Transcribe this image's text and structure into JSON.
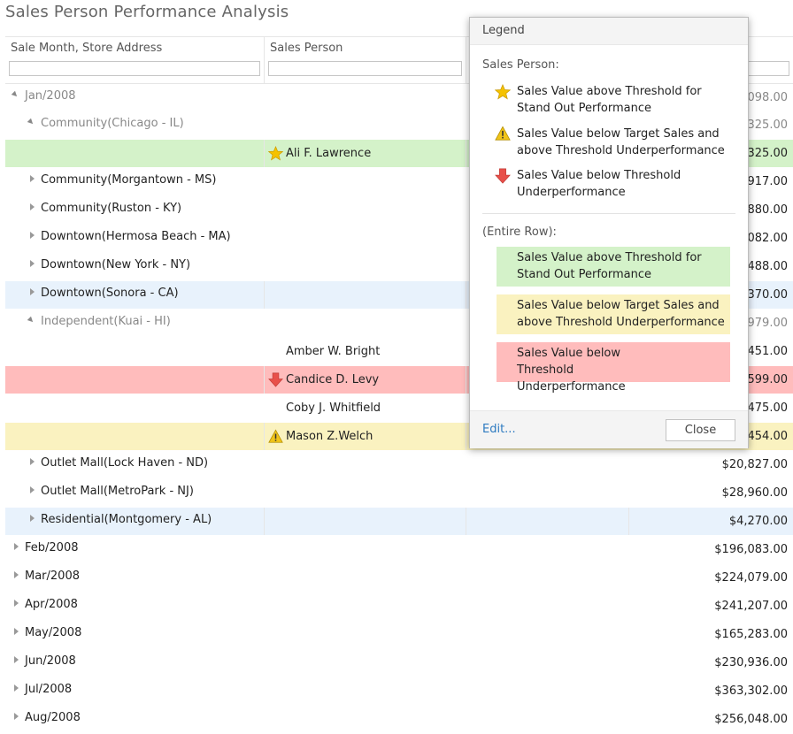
{
  "page": {
    "title": "Sales Person Performance Analysis"
  },
  "columns": {
    "month_store": "Sale Month, Store Address",
    "sales_person": "Sales Person"
  },
  "rows": [
    {
      "label": "Jan/2008",
      "amount": "098.00"
    },
    {
      "label": "Community(Chicago - IL)",
      "amount": "325.00"
    },
    {
      "person": "Ali F. Lawrence",
      "amount": "325.00"
    },
    {
      "label": "Community(Morgantown - MS)",
      "amount": "917.00"
    },
    {
      "label": "Community(Ruston - KY)",
      "amount": "880.00"
    },
    {
      "label": "Downtown(Hermosa Beach - MA)",
      "amount": "082.00"
    },
    {
      "label": "Downtown(New York - NY)",
      "amount": "488.00"
    },
    {
      "label": "Downtown(Sonora - CA)",
      "amount": "370.00"
    },
    {
      "label": "Independent(Kuai - HI)",
      "amount": "979.00"
    },
    {
      "person": "Amber W. Bright",
      "amount": "451.00"
    },
    {
      "person": "Candice D. Levy",
      "amount": "599.00"
    },
    {
      "person": "Coby J. Whitfield",
      "amount": "475.00"
    },
    {
      "person": "Mason Z.Welch",
      "amount": "454.00"
    },
    {
      "label": "Outlet Mall(Lock Haven - ND)",
      "amount": "$20,827.00"
    },
    {
      "label": "Outlet Mall(MetroPark - NJ)",
      "amount": "$28,960.00"
    },
    {
      "label": "Residential(Montgomery - AL)",
      "amount": "$4,270.00"
    },
    {
      "label": "Feb/2008",
      "amount": "$196,083.00"
    },
    {
      "label": "Mar/2008",
      "amount": "$224,079.00"
    },
    {
      "label": "Apr/2008",
      "amount": "$241,207.00"
    },
    {
      "label": "May/2008",
      "amount": "$165,283.00"
    },
    {
      "label": "Jun/2008",
      "amount": "$230,936.00"
    },
    {
      "label": "Jul/2008",
      "amount": "$363,302.00"
    },
    {
      "label": "Aug/2008",
      "amount": "$256,048.00"
    }
  ],
  "legend": {
    "title": "Legend",
    "sales_person_heading": "Sales Person:",
    "star_text": "Sales Value above Threshold for Stand Out Performance",
    "warning_text": "Sales Value below Target Sales and above Threshold Underperformance",
    "arrow_text": "Sales Value below Threshold Underperformance",
    "entire_row_heading": "(Entire Row):",
    "green_text": "Sales Value above Threshold for Stand Out Performance",
    "yellow_text": "Sales Value below Target Sales and above Threshold Underperformance",
    "red_text": "Sales Value below Threshold Underperformance",
    "edit_label": "Edit...",
    "close_label": "Close"
  },
  "colors": {
    "green_row": "#d4f2c9",
    "yellow_row": "#faf2c0",
    "red_row": "#ffbcbc",
    "highlight_row": "#e8f2fc",
    "star": "#f5c200",
    "warning": "#f0c419",
    "down_arrow": "#e8504a",
    "link": "#2d7ac0"
  },
  "icons": {
    "star": "star-icon",
    "warning": "warning-icon",
    "down_arrow": "down-arrow-icon",
    "expand": "expand-arrow-icon",
    "collapse": "collapse-arrow-icon"
  }
}
